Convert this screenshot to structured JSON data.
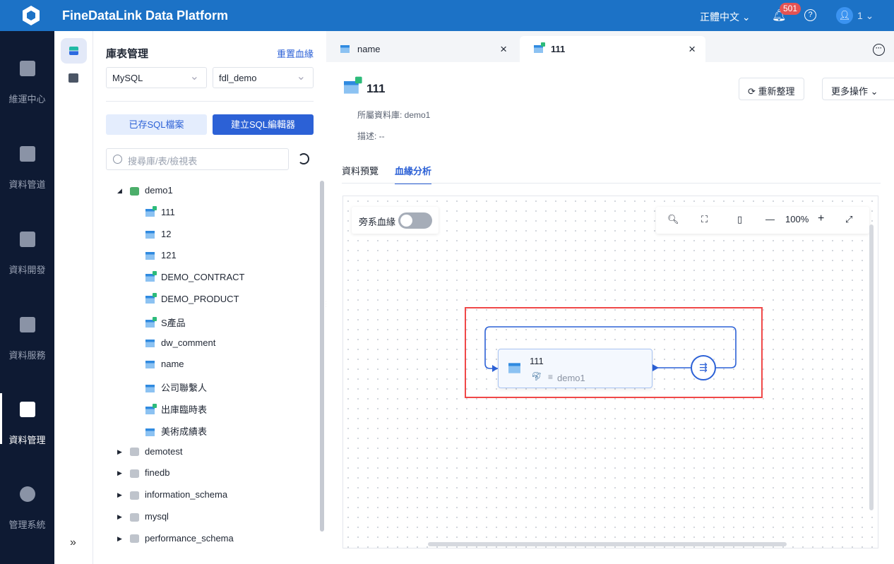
{
  "header": {
    "title": "FineDataLink Data Platform",
    "language": "正體中文",
    "notification_count": "501",
    "help": "?",
    "user": "1"
  },
  "sidebar": {
    "items": [
      {
        "label": "維運中心"
      },
      {
        "label": "資料管道"
      },
      {
        "label": "資料開發"
      },
      {
        "label": "資料服務"
      },
      {
        "label": "資料管理",
        "active": true
      },
      {
        "label": "管理系統"
      }
    ],
    "expand": "»"
  },
  "tree_panel": {
    "title": "庫表管理",
    "reset_link": "重置血緣",
    "db_type": "MySQL",
    "connection": "fdl_demo",
    "saved_sql_button": "已存SQL檔案",
    "create_sql_button": "建立SQL編輯器",
    "search_placeholder": "搜尋庫/表/檢視表",
    "databases": [
      {
        "name": "demo1",
        "expanded": true,
        "tables": [
          "111",
          "12",
          "121",
          "DEMO_CONTRACT",
          "DEMO_PRODUCT",
          "S產品",
          "dw_comment",
          "name",
          "公司聯繫人",
          "出庫臨時表",
          "美術成績表"
        ]
      },
      {
        "name": "demotest"
      },
      {
        "name": "finedb"
      },
      {
        "name": "information_schema"
      },
      {
        "name": "mysql"
      },
      {
        "name": "performance_schema"
      }
    ]
  },
  "tabs": [
    {
      "label": "name",
      "close": "×"
    },
    {
      "label": "111",
      "close": "×",
      "active": true
    }
  ],
  "detail": {
    "title": "111",
    "database_label": "所屬資料庫: demo1",
    "description_label": "描述: --",
    "refresh_button": "重新整理",
    "more_actions_button": "更多操作",
    "subtabs": [
      "資料預覽",
      "血緣分析"
    ],
    "active_subtab": "血緣分析"
  },
  "lineage": {
    "side_lineage_label": "旁系血緣",
    "side_lineage_on": false,
    "zoom": "100%",
    "node": {
      "name": "111",
      "database": "demo1"
    }
  }
}
